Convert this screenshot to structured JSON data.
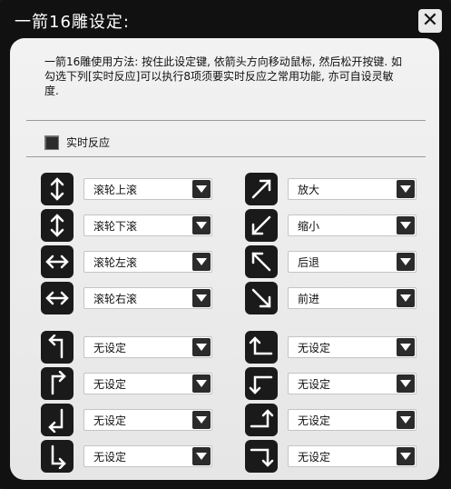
{
  "title": "一箭16雕设定:",
  "instructions": "一箭16雕使用方法: 按住此设定键, 依箭头方向移动鼠标, 然后松开按键. 如勾选下列[实时反应]可以执行8项须要实时反应之常用功能, 亦可自设灵敏度.",
  "realtime_checkbox": {
    "label": "实时反应",
    "checked": false
  },
  "gestures_left": [
    {
      "icon": "arrow-up-down-icon",
      "value": "滚轮上滚"
    },
    {
      "icon": "arrow-up-down-icon",
      "value": "滚轮下滚"
    },
    {
      "icon": "arrow-left-right-icon",
      "value": "滚轮左滚"
    },
    {
      "icon": "arrow-left-right-icon",
      "value": "滚轮右滚"
    },
    {
      "icon": "arrow-up-left-turn-icon",
      "value": "无设定"
    },
    {
      "icon": "arrow-up-right-turn-icon",
      "value": "无设定"
    },
    {
      "icon": "arrow-down-left-turn-icon",
      "value": "无设定"
    },
    {
      "icon": "arrow-down-right-turn-icon",
      "value": "无设定"
    }
  ],
  "gestures_right": [
    {
      "icon": "arrow-up-right-diagonal-icon",
      "value": "放大"
    },
    {
      "icon": "arrow-down-left-diagonal-icon",
      "value": "缩小"
    },
    {
      "icon": "arrow-up-left-diagonal-icon",
      "value": "后退"
    },
    {
      "icon": "arrow-down-right-diagonal-icon",
      "value": "前进"
    },
    {
      "icon": "arrow-left-up-turn-icon",
      "value": "无设定"
    },
    {
      "icon": "arrow-left-down-turn-icon",
      "value": "无设定"
    },
    {
      "icon": "arrow-right-up-turn-icon",
      "value": "无设定"
    },
    {
      "icon": "arrow-right-down-turn-icon",
      "value": "无设定"
    }
  ]
}
